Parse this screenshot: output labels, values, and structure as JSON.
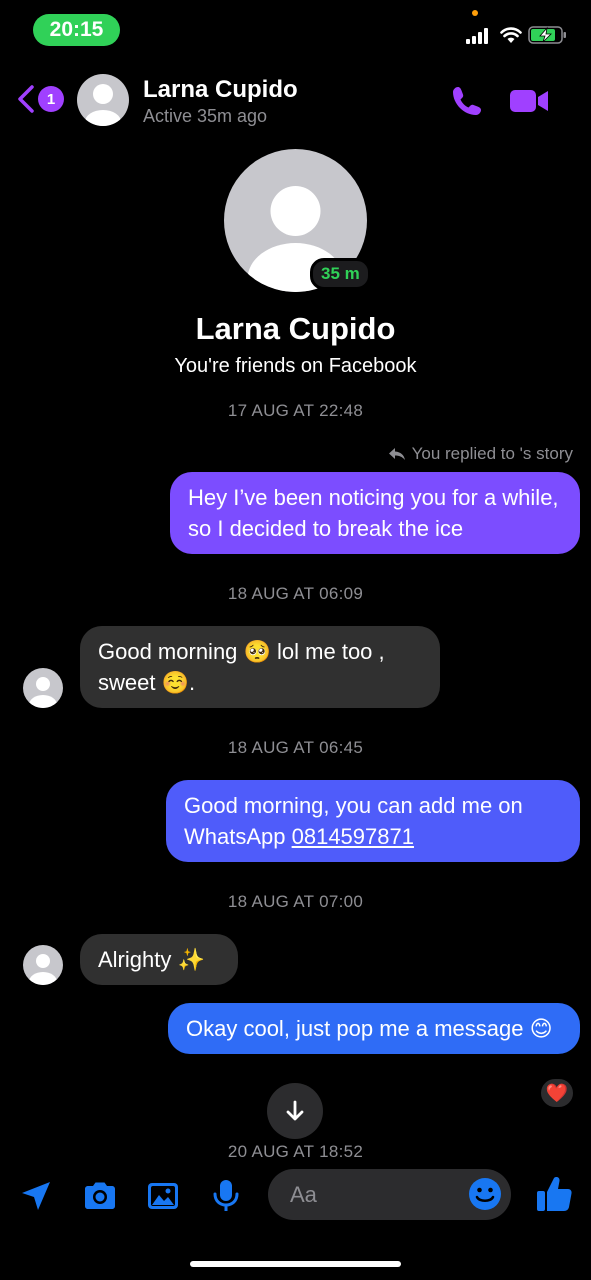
{
  "status_bar": {
    "time": "20:15"
  },
  "header": {
    "back_badge": "1",
    "name": "Larna Cupido",
    "status": "Active 35m ago"
  },
  "profile": {
    "name": "Larna Cupido",
    "subtitle": "You're friends on Facebook",
    "active_badge": "35 m"
  },
  "conversation": {
    "timestamps": [
      "17 AUG AT 22:48",
      "18 AUG AT 06:09",
      "18 AUG AT 06:45",
      "18 AUG AT 07:00",
      "20 AUG AT 18:52"
    ],
    "replied_label": "You replied to 's story",
    "messages": [
      {
        "direction": "out",
        "text": "Hey I’ve been noticing you for a while, so I decided to break the ice"
      },
      {
        "direction": "in",
        "text": "Good morning 🥺 lol me too , sweet ☺️."
      },
      {
        "direction": "out",
        "text_prefix": "Good morning, you can add me on WhatsApp ",
        "link": "0814597871"
      },
      {
        "direction": "in",
        "text": "Alrighty ✨"
      },
      {
        "direction": "out",
        "text": "Okay cool, just pop me a message 😊",
        "reaction": "❤️"
      }
    ]
  },
  "composer": {
    "placeholder": "Aa"
  },
  "colors": {
    "accent": "#a040ff",
    "bubble_gradient_top": "#8a3ffc",
    "bubble_gradient_bottom": "#1f6bff",
    "incoming_bubble": "#303030",
    "active_green": "#30d158",
    "composer_icon": "#1877f2"
  },
  "icons": [
    "back-chevron-icon",
    "phone-icon",
    "video-camera-icon",
    "location-arrow-icon",
    "camera-icon",
    "image-icon",
    "microphone-icon",
    "emoji-icon",
    "thumbs-up-icon",
    "arrow-down-icon",
    "reply-arrow-icon"
  ]
}
